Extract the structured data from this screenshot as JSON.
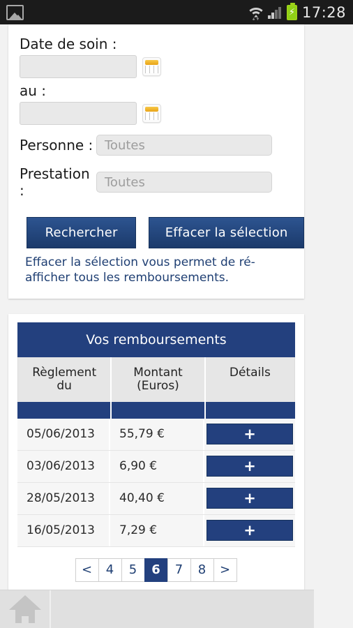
{
  "statusbar": {
    "gallery_icon": "gallery-icon",
    "wifi_icon": "wifi-icon",
    "signal_icon": "signal-icon",
    "battery_icon": "battery-charging-icon",
    "battery_bolt": "⚡",
    "time": "17:28"
  },
  "colors": {
    "navy": "#23407e",
    "navy_dark": "#1b3a6b",
    "link_navy": "#1f3f73",
    "page_bg": "#f2f2f2",
    "input_bg": "#e9e9e9",
    "battery_green": "#8fd117"
  },
  "search": {
    "date_label": "Date de soin :",
    "date_from_value": "",
    "date_from_placeholder": "",
    "date_to_label": "au :",
    "date_to_value": "",
    "date_to_placeholder": "",
    "calendar_icon": "calendar-icon",
    "person_label": "Personne :",
    "person_value": "Toutes",
    "prestation_label": "Prestation :",
    "prestation_value": "Toutes",
    "search_button": "Rechercher",
    "clear_button": "Effacer la sélection",
    "help_text": "Effacer la sélection vous permet de ré-afficher tous les remboursements."
  },
  "results": {
    "title": "Vos remboursements",
    "columns": [
      {
        "line1": "Règlement",
        "line2": "du"
      },
      {
        "line1": "Montant",
        "line2": "(Euros)"
      },
      {
        "line1": "Détails",
        "line2": ""
      }
    ],
    "rows": [
      {
        "date": "05/06/2013",
        "amount": "55,79 €",
        "details_label": "+"
      },
      {
        "date": "03/06/2013",
        "amount": "6,90 €",
        "details_label": "+"
      },
      {
        "date": "28/05/2013",
        "amount": "40,40 €",
        "details_label": "+"
      },
      {
        "date": "16/05/2013",
        "amount": "7,29 €",
        "details_label": "+"
      }
    ]
  },
  "pagination": {
    "prev": "<",
    "next": ">",
    "pages": [
      "4",
      "5",
      "6",
      "7",
      "8"
    ],
    "current": "6"
  },
  "bottom": {
    "home_icon": "home-icon"
  }
}
